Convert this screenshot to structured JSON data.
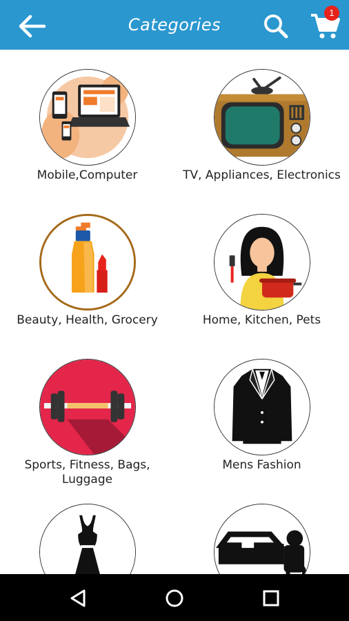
{
  "header": {
    "title": "Categories",
    "cart_badge": "1",
    "colors": {
      "bar": "#2a97cf",
      "badge": "#e8231c"
    }
  },
  "categories": [
    {
      "label": "Mobile,Computer",
      "icon": "devices-icon"
    },
    {
      "label": "TV, Appliances, Electronics",
      "icon": "tv-icon"
    },
    {
      "label": "Beauty, Health, Grocery",
      "icon": "cosmetics-icon"
    },
    {
      "label": "Home, Kitchen, Pets",
      "icon": "chef-icon"
    },
    {
      "label": "Sports, Fitness, Bags, Luggage",
      "icon": "dumbbell-icon"
    },
    {
      "label": "Mens Fashion",
      "icon": "suit-icon"
    },
    {
      "label": "",
      "icon": "dress-icon"
    },
    {
      "label": "",
      "icon": "vehicles-icon"
    }
  ],
  "system_nav": {
    "back": "back-nav-icon",
    "home": "home-nav-icon",
    "recents": "recents-nav-icon"
  }
}
